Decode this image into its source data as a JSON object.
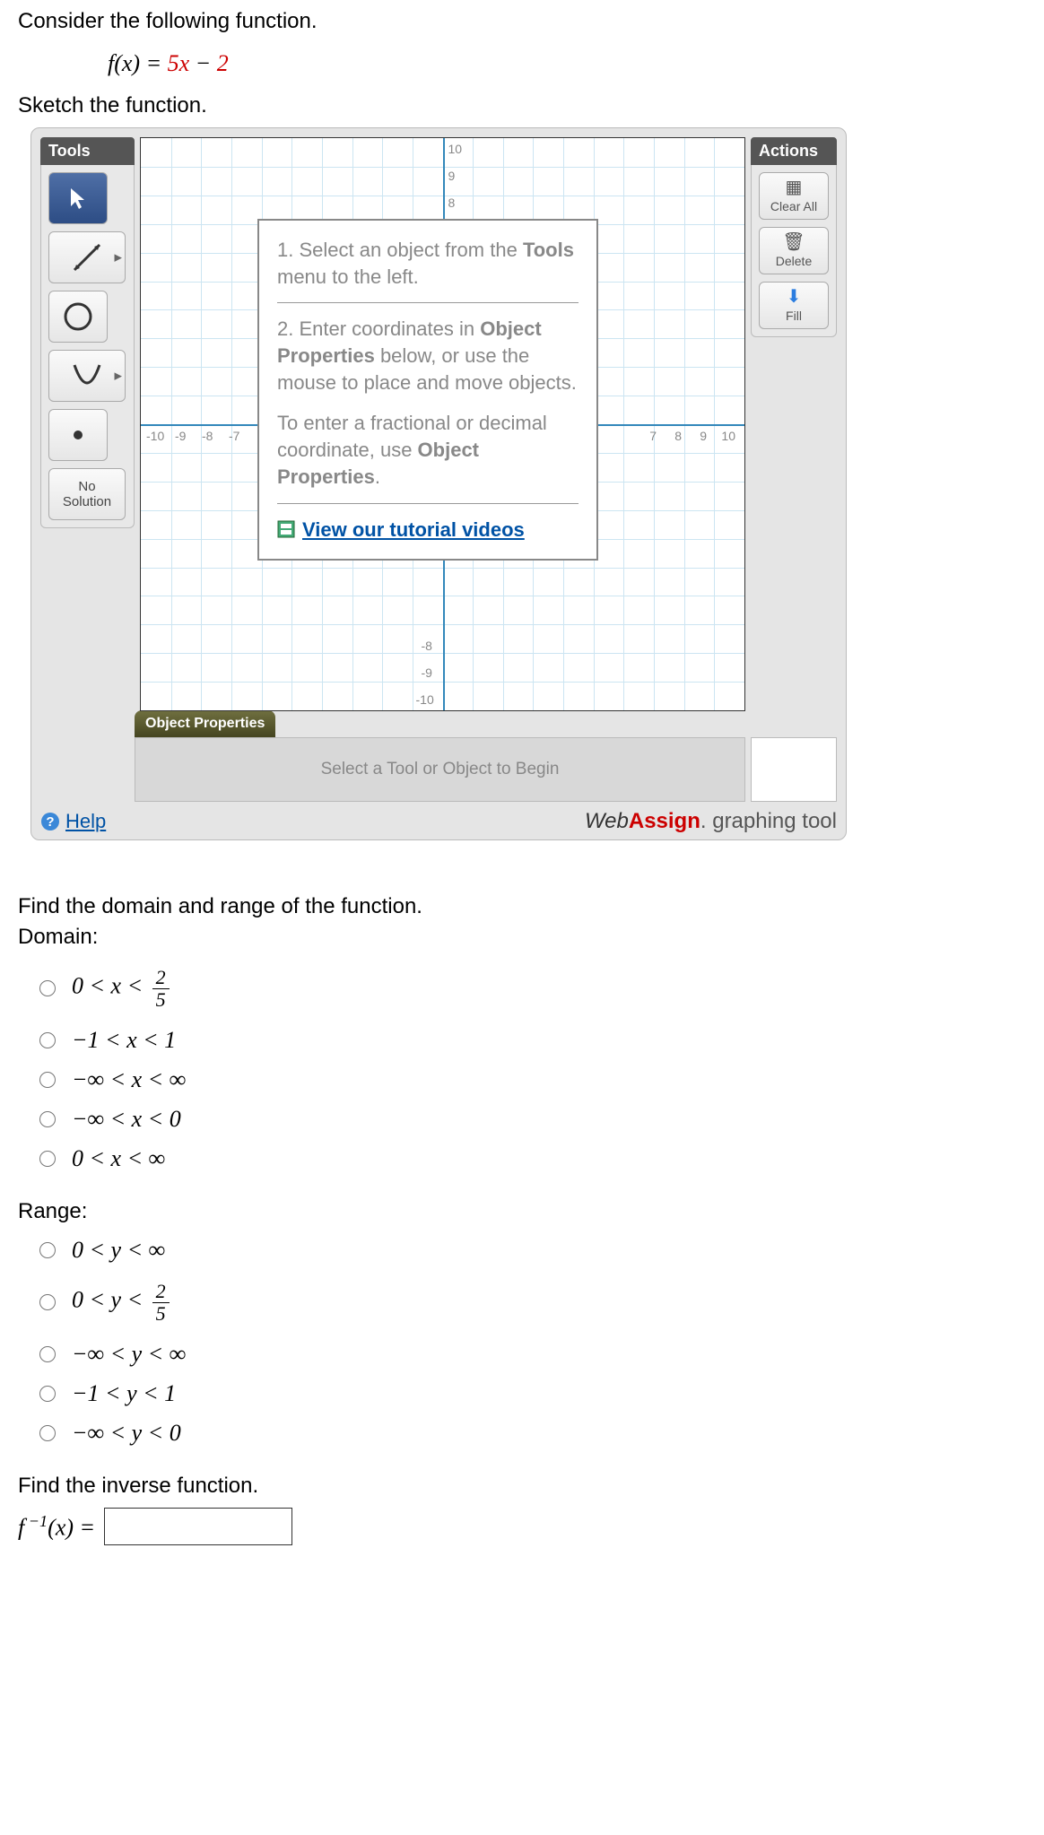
{
  "intro": "Consider the following function.",
  "func_lhs": "f(x) = ",
  "func_mid": "5x",
  "func_minus": " − ",
  "func_rhs": "2",
  "sketch": "Sketch the function.",
  "tools": {
    "header": "Tools",
    "no_solution": "No\nSolution"
  },
  "actions": {
    "header": "Actions",
    "clear_all": "Clear All",
    "delete": "Delete",
    "fill": "Fill"
  },
  "chart_data": {
    "type": "line",
    "xlim": [
      -10,
      10
    ],
    "ylim": [
      -10,
      10
    ],
    "xticks_left": [
      "-10",
      "-9",
      "-8",
      "-7"
    ],
    "xticks_right": [
      "7",
      "8",
      "9",
      "10"
    ],
    "yticks_top": [
      "10",
      "9",
      "8"
    ],
    "yticks_bottom": [
      "-8",
      "-9",
      "-10"
    ],
    "grid": true,
    "series": []
  },
  "instructions": {
    "step1": "1. Select an object from the ",
    "step1b": "Tools",
    "step1c": " menu to the left.",
    "step2a": "2. Enter coordinates in ",
    "step2b": "Object Properties",
    "step2c": " below, or use the mouse to place and move objects.",
    "step3a": "To enter a fractional or decimal coordinate, use ",
    "step3b": "Object Properties",
    "step3c": ".",
    "tutorial": "View our tutorial videos"
  },
  "object_properties": {
    "tab": "Object Properties",
    "placeholder": "Select a Tool or Object to Begin"
  },
  "help": "Help",
  "brand_suffix": " graphing tool",
  "q_domain_range": "Find the domain and range of the function.",
  "domain_label": "Domain:",
  "domain_options": [
    "0 < x < 2/5",
    "−1 < x < 1",
    "−∞ < x < ∞",
    "−∞ < x < 0",
    "0 < x < ∞"
  ],
  "range_label": "Range:",
  "range_options": [
    "0 < y < ∞",
    "0 < y < 2/5",
    "−∞ < y < ∞",
    "−1 < y < 1",
    "−∞ < y < 0"
  ],
  "inverse_prompt": "Find the inverse function.",
  "inverse_lhs": "f⁻¹(x) = "
}
